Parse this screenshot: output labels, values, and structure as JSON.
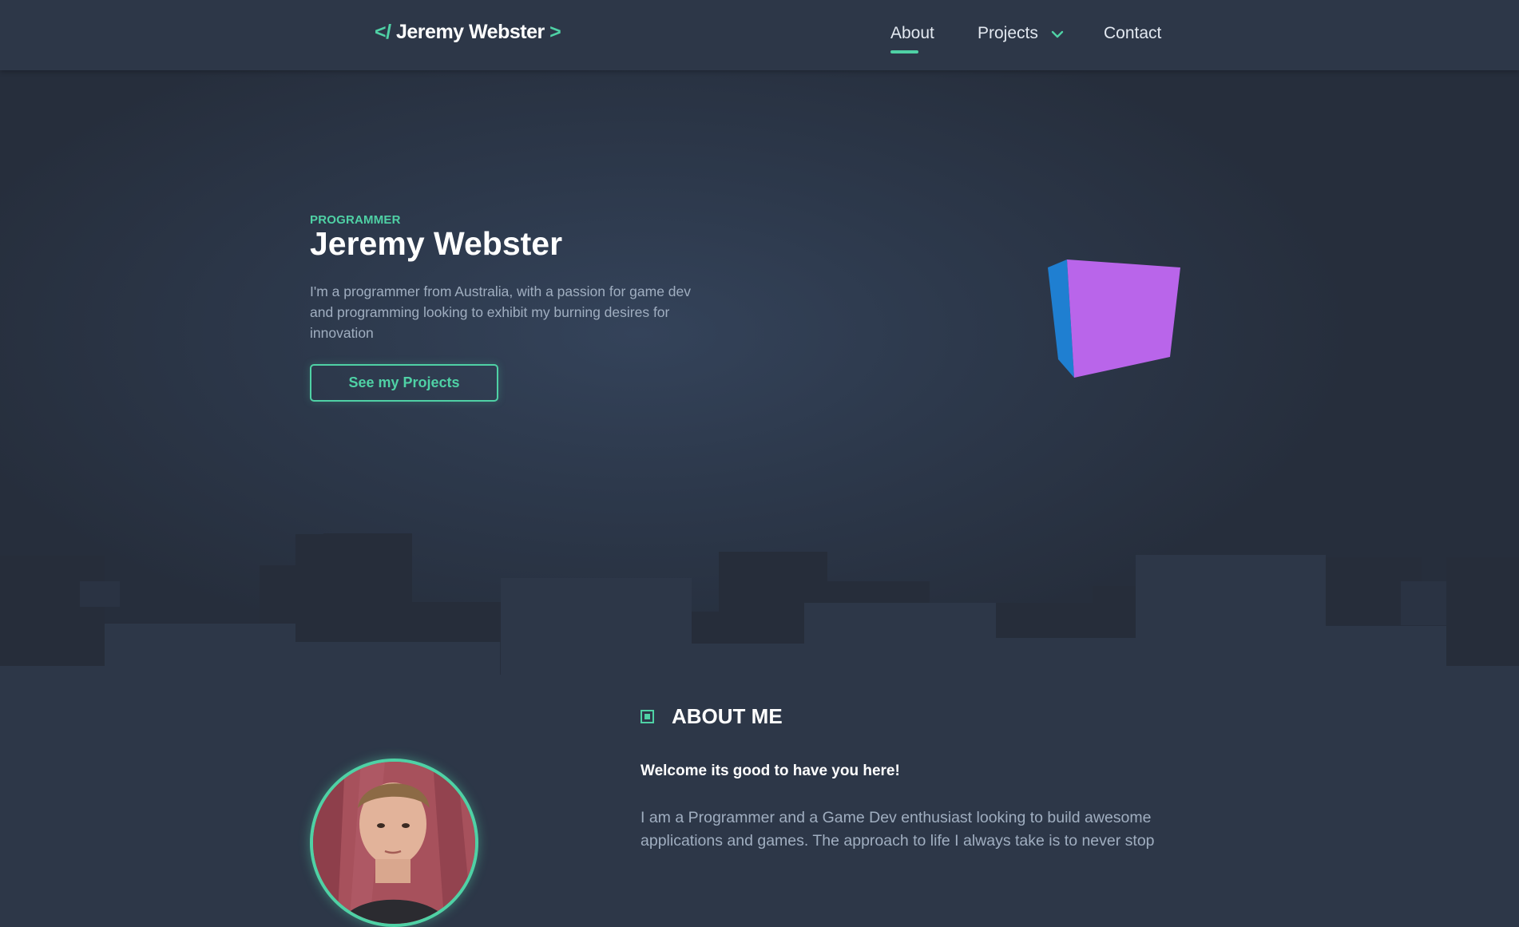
{
  "nav": {
    "logo_open": "</",
    "logo_name": "Jeremy Webster",
    "logo_close": ">",
    "about": "About",
    "projects": "Projects",
    "contact": "Contact",
    "active": "About"
  },
  "hero": {
    "eyebrow": "PROGRAMMER",
    "title": "Jeremy Webster",
    "description": "I'm a programmer from Australia, with a passion for game dev and programming looking to exhibit my burning desires for innovation",
    "button_label": "See my Projects"
  },
  "about": {
    "heading": "ABOUT ME",
    "welcome": "Welcome its good to have you here!",
    "body": "I am a Programmer and a Game Dev enthusiast looking to build awesome applications and games. The approach to life I always take is to never stop"
  },
  "colors": {
    "accent": "#4fd1a5",
    "background": "#2d3748",
    "cube_front": "#b965ea",
    "cube_side": "#1f7fd1"
  },
  "icons": {
    "nav_projects": "chevron-down-icon",
    "about_heading": "square-bullet-icon"
  }
}
